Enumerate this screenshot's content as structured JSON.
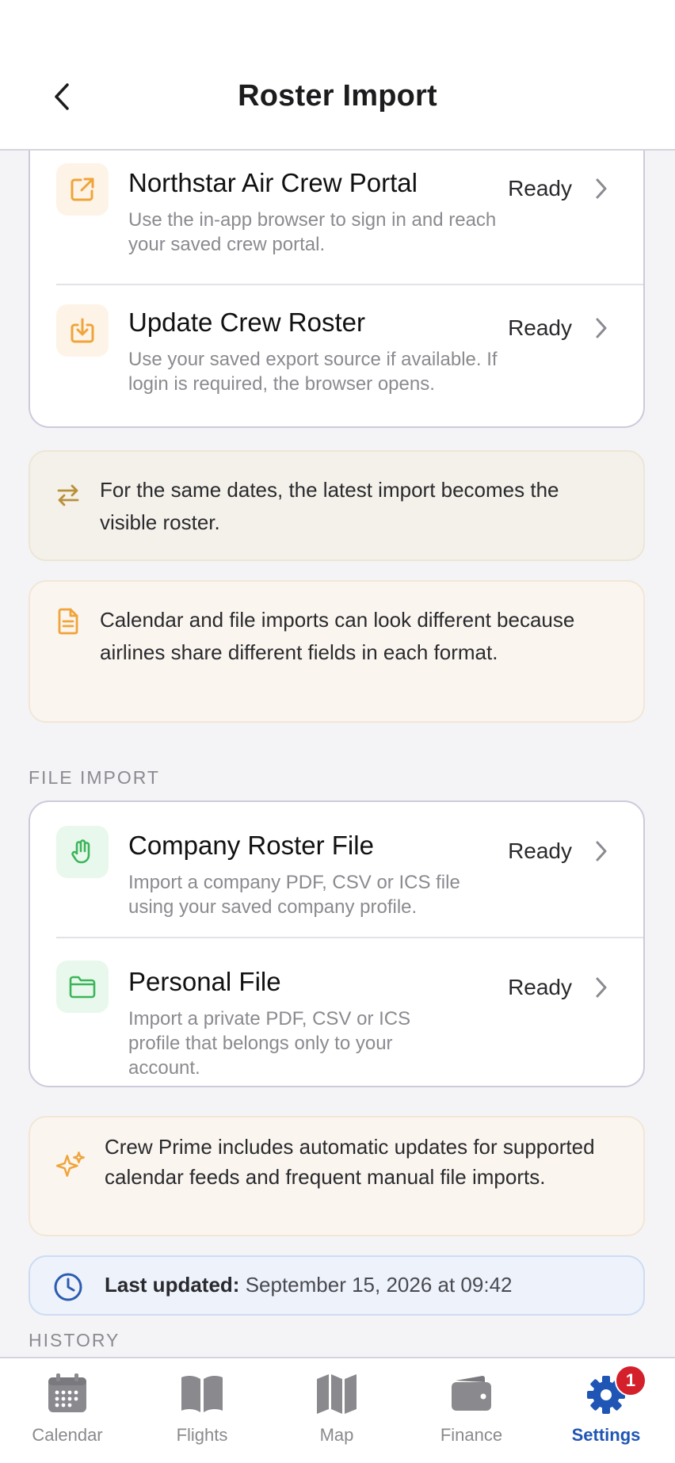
{
  "header": {
    "title": "Roster Import",
    "back_icon": "chevron-left-icon"
  },
  "portal_card": {
    "items": [
      {
        "title": "Northstar Air Crew Portal",
        "description": "Use the in-app browser to sign in and reach your saved crew portal.",
        "status": "Ready",
        "icon": "external-link-icon"
      },
      {
        "title": "Update Crew Roster",
        "description": "Use your saved export source if available. If login is required, the browser opens.",
        "status": "Ready",
        "icon": "download-icon"
      }
    ]
  },
  "notices": {
    "latest_import": "For the same dates, the latest import becomes the visible roster.",
    "format_difference": "Calendar and file imports can look different because airlines share different fields in each format."
  },
  "file_import": {
    "section_label": "FILE IMPORT",
    "items": [
      {
        "title": "Company Roster File",
        "description": "Import a company PDF, CSV or ICS file using your saved company profile.",
        "status": "Ready",
        "icon": "file-hand-icon"
      },
      {
        "title": "Personal File",
        "description": "Import a private PDF, CSV or ICS profile that belongs only to your account.",
        "status": "Ready",
        "icon": "folder-icon"
      }
    ]
  },
  "crew_prime_notice": "Crew Prime includes automatic updates for supported calendar feeds and frequent manual file imports.",
  "last_updated": {
    "label": "Last updated:",
    "value": "September 15, 2026 at 09:42"
  },
  "history": {
    "section_label": "HISTORY"
  },
  "tabbar": {
    "tabs": [
      {
        "label": "Calendar",
        "icon": "calendar-icon",
        "active": false
      },
      {
        "label": "Flights",
        "icon": "book-icon",
        "active": false
      },
      {
        "label": "Map",
        "icon": "map-icon",
        "active": false
      },
      {
        "label": "Finance",
        "icon": "wallet-icon",
        "active": false
      },
      {
        "label": "Settings",
        "icon": "gear-icon",
        "active": true,
        "badge": "1"
      }
    ]
  },
  "colors": {
    "accent_blue": "#1f55b5",
    "orange": "#f0a43a",
    "green": "#3cb55a",
    "badge_red": "#d3202b"
  }
}
